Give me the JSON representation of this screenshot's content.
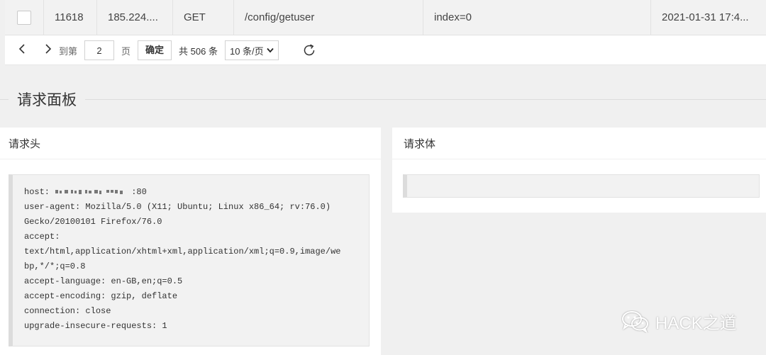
{
  "table": {
    "row": {
      "id": "11618",
      "ip": "185.224....",
      "method": "GET",
      "path": "/config/getuser",
      "query": "index=0",
      "time": "2021-01-31 17:4..."
    }
  },
  "pager": {
    "prev_icon": "chevron-left-icon",
    "next_icon": "chevron-right-icon",
    "goto_label": "到第",
    "page_value": "2",
    "page_unit": "页",
    "confirm_label": "确定",
    "total_text": "共 506 条",
    "page_size": "10 条/页",
    "refresh_icon": "refresh-icon"
  },
  "section": {
    "title": "请求面板"
  },
  "request_header": {
    "title": "请求头",
    "host_prefix": "host: ",
    "host_suffix": ":80",
    "lines": [
      "user-agent: Mozilla/5.0 (X11; Ubuntu; Linux x86_64; rv:76.0)",
      "Gecko/20100101 Firefox/76.0",
      "accept:",
      "text/html,application/xhtml+xml,application/xml;q=0.9,image/we",
      "bp,*/*;q=0.8",
      "accept-language: en-GB,en;q=0.5",
      "accept-encoding: gzip, deflate",
      "connection: close",
      "upgrade-insecure-requests: 1"
    ]
  },
  "request_body": {
    "title": "请求体",
    "content": ""
  },
  "watermark": {
    "text": "HACK之道",
    "icon": "wechat-icon"
  }
}
